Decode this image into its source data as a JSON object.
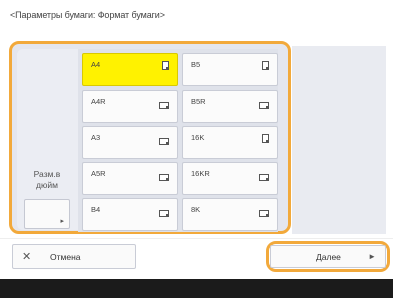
{
  "header": {
    "title": "<Параметры бумаги: Формат бумаги>"
  },
  "paper_sizes": [
    {
      "label": "A4",
      "orientation": "portrait",
      "selected": true
    },
    {
      "label": "B5",
      "orientation": "portrait",
      "selected": false
    },
    {
      "label": "A4R",
      "orientation": "landscape",
      "selected": false
    },
    {
      "label": "B5R",
      "orientation": "landscape",
      "selected": false
    },
    {
      "label": "A3",
      "orientation": "landscape",
      "selected": false
    },
    {
      "label": "16K",
      "orientation": "portrait",
      "selected": false
    },
    {
      "label": "A5R",
      "orientation": "landscape",
      "selected": false
    },
    {
      "label": "16KR",
      "orientation": "landscape",
      "selected": false
    },
    {
      "label": "B4",
      "orientation": "landscape",
      "selected": false
    },
    {
      "label": "8K",
      "orientation": "landscape",
      "selected": false
    }
  ],
  "inch_sizes": {
    "label_line1": "Разм.в",
    "label_line2": "дюйм"
  },
  "footer": {
    "cancel_label": "Отмена",
    "next_label": "Далее"
  },
  "colors": {
    "accent": "#f2a93b",
    "selected": "#fff200"
  }
}
